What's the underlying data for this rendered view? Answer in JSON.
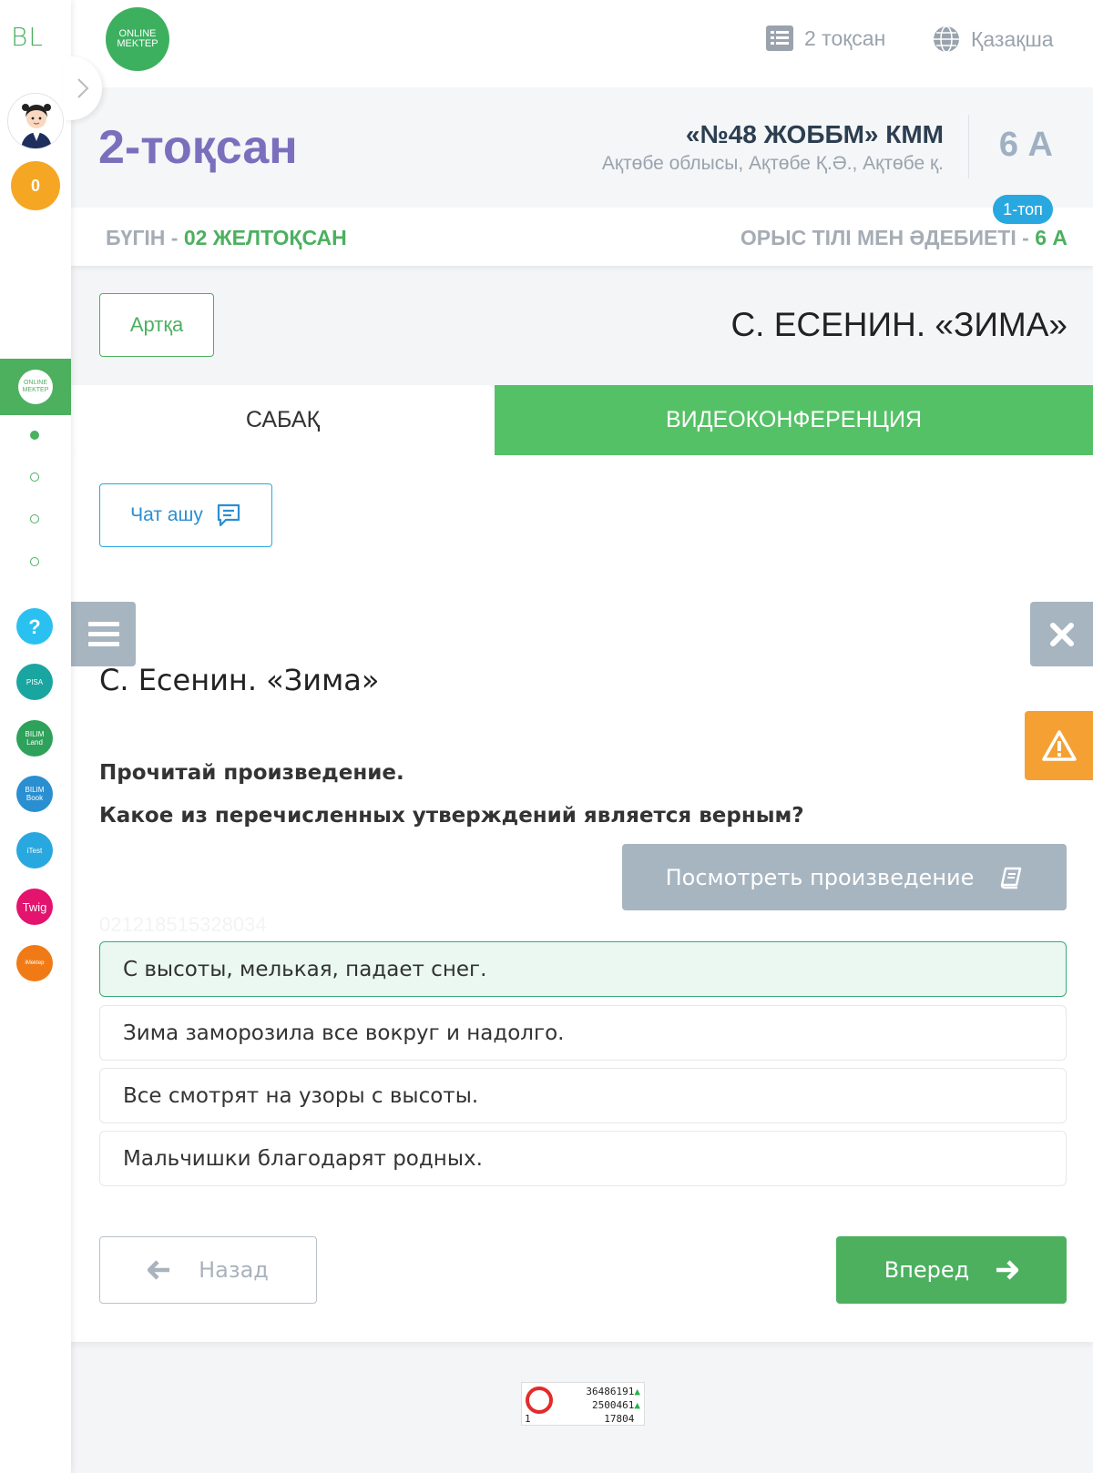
{
  "sidebar": {
    "logo": "BL",
    "coins": "0",
    "active_logo": "ONLINE MEKTEP",
    "apps": [
      {
        "name": "help",
        "label": "?",
        "color": "#2ac1f0"
      },
      {
        "name": "pisa",
        "label": "PISA",
        "color": "#1aa6a0"
      },
      {
        "name": "bilimland",
        "label": "BILIM Land",
        "color": "#2ea15a"
      },
      {
        "name": "bilimbook",
        "label": "BILIM Book",
        "color": "#2a8fd0"
      },
      {
        "name": "itest",
        "label": "iTest",
        "color": "#29a8e0"
      },
      {
        "name": "twig",
        "label": "Twig",
        "color": "#e3136e"
      },
      {
        "name": "imektep",
        "label": "iMektep",
        "color": "#f07b16"
      }
    ]
  },
  "topbar": {
    "logo": "ONLINE MEKTEP",
    "quarter_link": "2 тоқсан",
    "language_link": "Қазақша"
  },
  "header": {
    "quarter_title": "2-тоқсан",
    "school_name": "«№48 ЖОББМ» КММ",
    "school_address": "Ақтөбе облысы, Ақтөбе Қ.Ә., Ақтөбе қ.",
    "class_label": "6 А",
    "group_badge": "1-топ"
  },
  "datebar": {
    "today_prefix": "БҮГІН - ",
    "today_date": "02 ЖЕЛТОҚСАН",
    "subject_prefix": "ОРЫС ТІЛІ МЕН ӘДЕБИЕТІ - ",
    "subject_class": "6 А"
  },
  "lesson": {
    "back_label": "Артқа",
    "title": "С. ЕСЕНИН. «ЗИМА»"
  },
  "tabs": {
    "lesson": "САБАҚ",
    "video": "ВИДЕОКОНФЕРЕНЦИЯ"
  },
  "content": {
    "chat_label": "Чат ашу",
    "task_title": "С. Есенин. «Зима»",
    "instruction": "Прочитай произведение.",
    "question": "Какое из перечисленных утверждений является верным?",
    "view_label": "Посмотреть произведение",
    "watermark": "021218515328034",
    "options": [
      "С высоты, мелькая, падает снег.",
      "Зима заморозила все вокруг и надолго.",
      "Все смотрят на узоры с высоты.",
      "Мальчишки благодарят родных."
    ],
    "selected_option": 0,
    "prev_label": "Назад",
    "next_label": "Вперед"
  },
  "counter": {
    "line1": "36486191",
    "line2": "2500461",
    "line3": "17804",
    "left": "1"
  },
  "colors": {
    "green": "#4cb05f",
    "purple": "#7b6fbd",
    "blue": "#29a8e0",
    "gray_button": "#a7b5c0",
    "warning": "#f5a033"
  }
}
